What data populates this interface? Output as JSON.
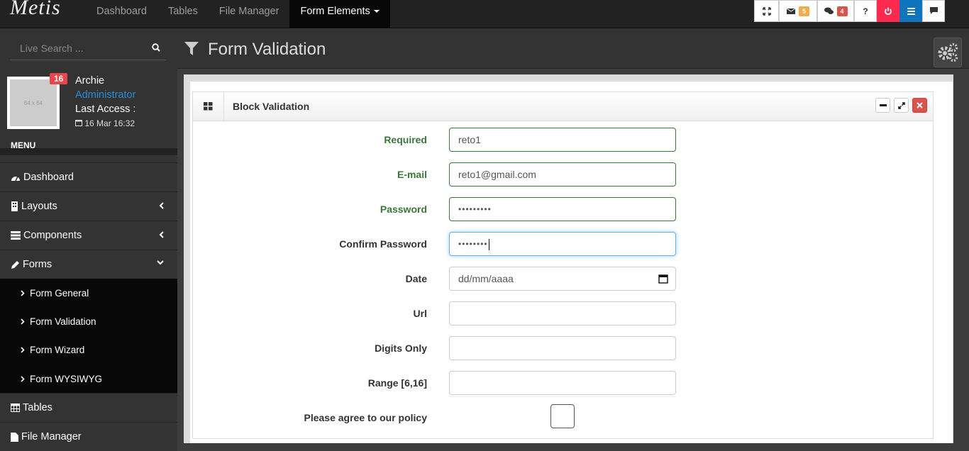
{
  "brand": "Metis",
  "topnav": {
    "items": [
      "Dashboard",
      "Tables",
      "File Manager"
    ],
    "active": "Form Elements"
  },
  "toolbar": {
    "mail_count": "5",
    "chat_count": "4",
    "help_label": "?",
    "colors": {
      "mail_badge": "#f0ad4e",
      "chat_badge": "#d9534f",
      "power": "#ff2a4e",
      "menu": "#0d74bd"
    }
  },
  "sidebar": {
    "search_placeholder": "Live Search ...",
    "user": {
      "badge": "16",
      "avatar_text": "64 x 64",
      "name": "Archie",
      "role": "Administrator",
      "last_access": "Last Access :",
      "date": "16 Mar 16:32"
    },
    "menu_header": "MENU",
    "items": [
      {
        "label": "Dashboard",
        "icon": "dashboard-icon"
      },
      {
        "label": "Layouts",
        "icon": "building-icon"
      },
      {
        "label": "Components",
        "icon": "tasks-icon"
      },
      {
        "label": "Forms",
        "icon": "pencil-icon"
      }
    ],
    "sub_items": [
      "Form General",
      "Form Validation",
      "Form Wizard",
      "Form WYSIWYG"
    ],
    "after_items": [
      {
        "label": "Tables",
        "icon": "table-icon"
      },
      {
        "label": "File Manager",
        "icon": "file-icon"
      }
    ]
  },
  "page": {
    "title": "Form Validation"
  },
  "panel": {
    "title": "Block Validation"
  },
  "form": {
    "required": {
      "label": "Required",
      "value": "reto1"
    },
    "email": {
      "label": "E-mail",
      "value": "reto1@gmail.com"
    },
    "password": {
      "label": "Password",
      "value": "•••••••••"
    },
    "confirm": {
      "label": "Confirm Password",
      "value": "••••••••"
    },
    "date": {
      "label": "Date",
      "value": "dd/mm/aaaa"
    },
    "url": {
      "label": "Url",
      "value": ""
    },
    "digits": {
      "label": "Digits Only",
      "value": ""
    },
    "range": {
      "label": "Range [6,16]",
      "value": ""
    },
    "policy": {
      "label": "Please agree to our policy"
    }
  }
}
